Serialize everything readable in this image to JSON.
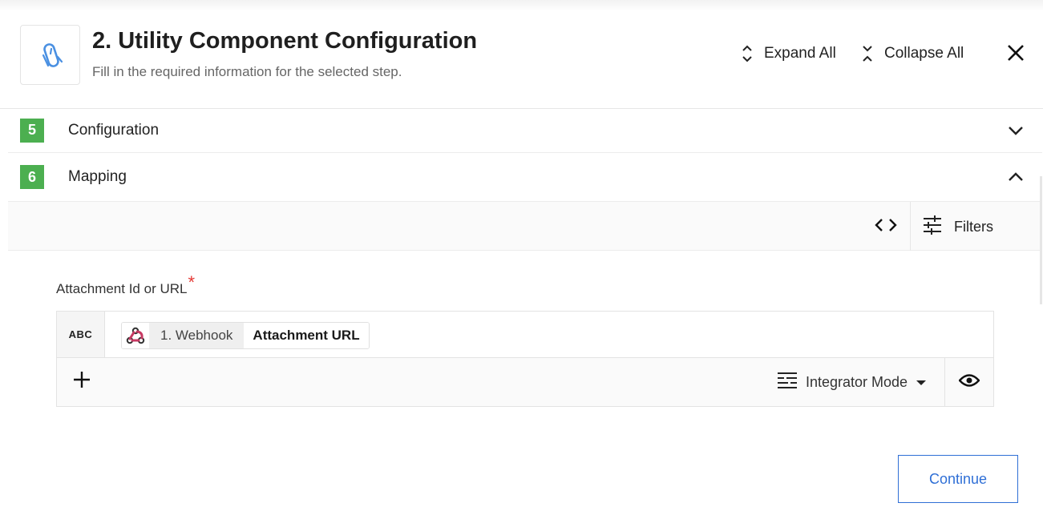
{
  "header": {
    "title": "2. Utility Component Configuration",
    "subtitle": "Fill in the required information for the selected step.",
    "app_icon": "utility-knife-icon",
    "expand_all_label": "Expand All",
    "collapse_all_label": "Collapse All",
    "close_icon": "close-icon"
  },
  "sections": [
    {
      "number": "5",
      "label": "Configuration",
      "state": "collapsed"
    },
    {
      "number": "6",
      "label": "Mapping",
      "state": "expanded"
    }
  ],
  "toolbar": {
    "code_icon": "code-icon",
    "filters_label": "Filters",
    "filters_icon": "sliders-icon"
  },
  "field": {
    "label": "Attachment Id or URL",
    "required_marker": "*",
    "type_label": "ABC",
    "value_pill": {
      "icon": "webhook-icon",
      "step_label": "1. Webhook",
      "field_label": "Attachment URL"
    },
    "add_icon": "plus-icon",
    "mode_label": "Integrator Mode",
    "mode_icon": "mode-lines-icon",
    "preview_icon": "eye-icon"
  },
  "footer": {
    "continue_label": "Continue"
  },
  "colors": {
    "step_badge": "#4caf50",
    "accent": "#2f6fd6",
    "required": "#e53935",
    "webhook_red": "#c73a63"
  }
}
